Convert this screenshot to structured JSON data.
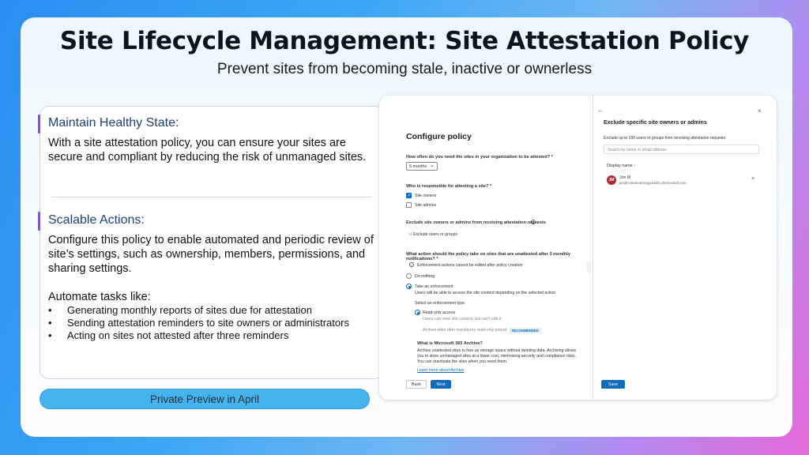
{
  "slide": {
    "title": "Site Lifecycle Management: Site Attestation Policy",
    "subtitle": "Prevent sites from becoming stale, inactive or ownerless",
    "section1": {
      "heading": "Maintain Healthy State:",
      "text": "With a site attestation policy, you can ensure your sites are secure and compliant by reducing the risk of unmanaged sites."
    },
    "section2": {
      "heading": "Scalable Actions:",
      "text": "Configure this policy to enable automated and periodic review of site’s settings, such as ownership, members, permissions, and sharing settings.",
      "automate_label": "Automate tasks like:",
      "bullets": [
        "Generating monthly reports of sites due for attestation",
        "Sending attestation reminders to site owners or administrators",
        "Acting on sites not attested after three reminders"
      ]
    },
    "preview_button": "Private Preview in April"
  },
  "configure_policy": {
    "title": "Configure policy",
    "q_frequency": "How often do you need the sites in your organization to be attested? *",
    "frequency_value": "6 months",
    "q_responsible": "Who is responsible for attesting a site? *",
    "opt_site_owners": "Site owners",
    "opt_site_admins": "Site admins",
    "q_exclude": "Exclude site owners or admins from receiving attestation requests",
    "exclude_link": "Exclude users or groups",
    "q_action": "What action should the policy take on sites that are unattested after 3 monthly notifications? *",
    "info_note": "Enforcement actions cannot be edited after policy creation",
    "opt_do_nothing": "Do nothing",
    "opt_take_enforcement": "Take an enforcement",
    "enforcement_desc": "Users will be able to access the site content depending on the selected action",
    "select_type": "Select an enforcement type",
    "opt_read_only": "Read-only access",
    "read_only_desc": "Users can view site content, but can't edit it.",
    "archive_text": "Archive sites after mandatory read-only period",
    "recommended_badge": "RECOMMENDED",
    "archive_heading": "What is Microsoft 365 Archive?",
    "archive_desc": "Archive unattested sites to free up storage space without deleting data. Archiving allows you to store unmanaged sites at a lower cost, minimizing security and compliance risks. You can reactivate the sites when you need them.",
    "archive_link": "Learn more about Archive",
    "back_button": "Back",
    "next_button": "Next"
  },
  "exclude_panel": {
    "title": "Exclude specific site owners or admins",
    "desc": "Exclude up to 100 users or groups from receiving attestation requests",
    "search_placeholder": "Search by name or email address",
    "column_header": "Display name",
    "user_initials": "JM",
    "user_name": "Jon M",
    "user_email": "jon@contosoenergyusa40.onmicrosoft.com",
    "save_button": "Save"
  },
  "colors": {
    "accent_blue": "#0f6cbd",
    "preview_button": "#45b4ee",
    "heading_blue": "#1f3f75",
    "avatar_red": "#b12b30"
  }
}
